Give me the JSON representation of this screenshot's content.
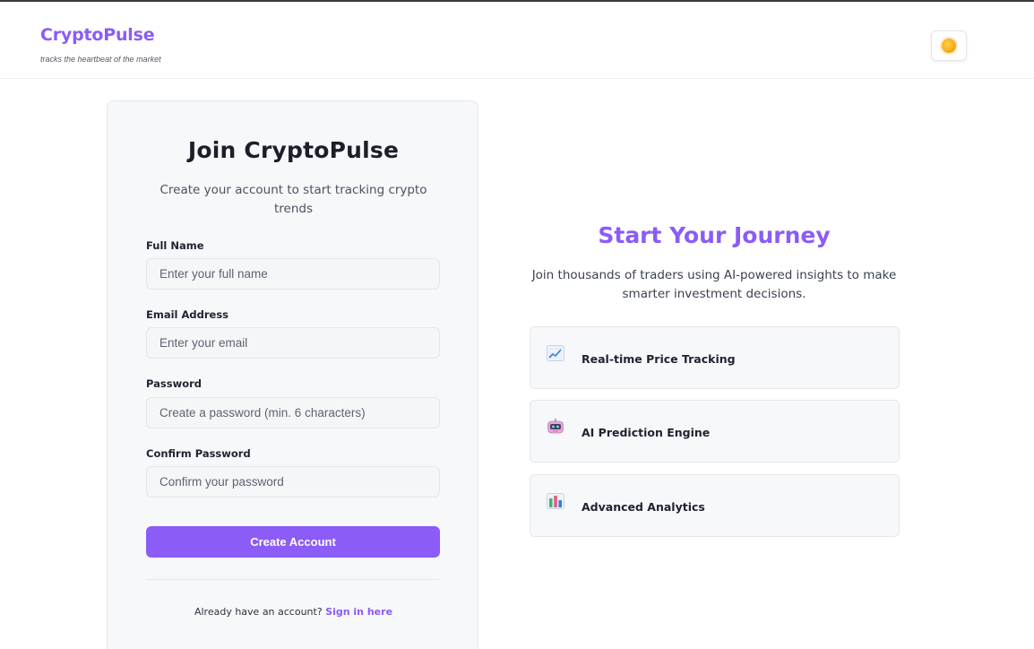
{
  "header": {
    "brand": "CryptoPulse",
    "tagline": "tracks the heartbeat of the market",
    "theme_toggle_icon": "sun-icon"
  },
  "signup": {
    "title": "Join CryptoPulse",
    "subtitle": "Create your account to start tracking crypto trends",
    "fields": [
      {
        "label": "Full Name",
        "placeholder": "Enter your full name",
        "value": ""
      },
      {
        "label": "Email Address",
        "placeholder": "Enter your email",
        "value": ""
      },
      {
        "label": "Password",
        "placeholder": "Create a password (min. 6 characters)",
        "value": ""
      },
      {
        "label": "Confirm Password",
        "placeholder": "Confirm your password",
        "value": ""
      }
    ],
    "submit_label": "Create Account",
    "signin_prompt": "Already have an account?",
    "signin_link": "Sign in here"
  },
  "promo": {
    "title": "Start Your Journey",
    "subtitle": "Join thousands of traders using AI-powered insights to make smarter investment decisions.",
    "features": [
      {
        "icon": "chart-increasing-icon",
        "label": "Real-time Price Tracking"
      },
      {
        "icon": "robot-icon",
        "label": "AI Prediction Engine"
      },
      {
        "icon": "bar-chart-icon",
        "label": "Advanced Analytics"
      }
    ]
  },
  "colors": {
    "accent": "#8b5cf6",
    "card_bg": "#f7f8fa",
    "border": "#e5e7ec"
  }
}
